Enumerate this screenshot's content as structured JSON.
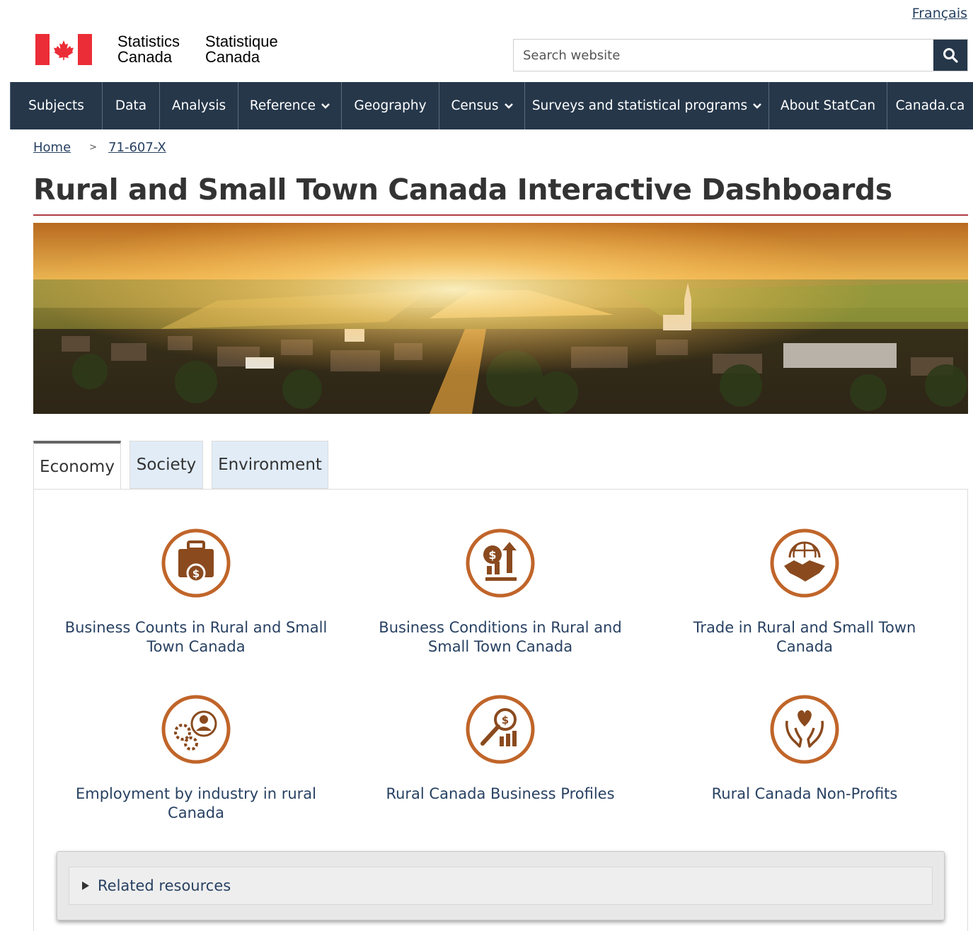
{
  "language_link": "Français",
  "header": {
    "signature_en": [
      "Statistics",
      "Canada"
    ],
    "signature_fr": [
      "Statistique",
      "Canada"
    ],
    "search_placeholder": "Search website"
  },
  "nav": {
    "items": [
      {
        "label": "Subjects",
        "dropdown": false
      },
      {
        "label": "Data",
        "dropdown": false
      },
      {
        "label": "Analysis",
        "dropdown": false
      },
      {
        "label": "Reference",
        "dropdown": true
      },
      {
        "label": "Geography",
        "dropdown": false
      },
      {
        "label": "Census",
        "dropdown": true
      },
      {
        "label": "Surveys and statistical programs",
        "dropdown": true
      },
      {
        "label": "About StatCan",
        "dropdown": false
      },
      {
        "label": "Canada.ca",
        "dropdown": false
      }
    ]
  },
  "breadcrumb": {
    "items": [
      "Home",
      "71-607-X"
    ],
    "separator": ">"
  },
  "page_title": "Rural and Small Town Canada Interactive Dashboards",
  "tabs": [
    {
      "label": "Economy",
      "active": true
    },
    {
      "label": "Society",
      "active": false
    },
    {
      "label": "Environment",
      "active": false
    }
  ],
  "cards": [
    {
      "label": "Business Counts in Rural and Small Town Canada",
      "icon": "briefcase-dollar-icon"
    },
    {
      "label": "Business Conditions in Rural and Small Town Canada",
      "icon": "growth-chart-dollar-icon"
    },
    {
      "label": "Trade in Rural and Small Town Canada",
      "icon": "globe-handshake-icon"
    },
    {
      "label": "Employment by industry in rural Canada",
      "icon": "gears-person-icon"
    },
    {
      "label": "Rural Canada Business Profiles",
      "icon": "magnifier-dollar-chart-icon"
    },
    {
      "label": "Rural Canada Non-Profits",
      "icon": "hands-heart-icon"
    }
  ],
  "related": {
    "label": "Related resources"
  },
  "colors": {
    "nav_bg": "#26374a",
    "link": "#284162",
    "accent_orange": "#c0652a",
    "title_rule": "#af3c43",
    "flag_red": "#eb2d37"
  }
}
